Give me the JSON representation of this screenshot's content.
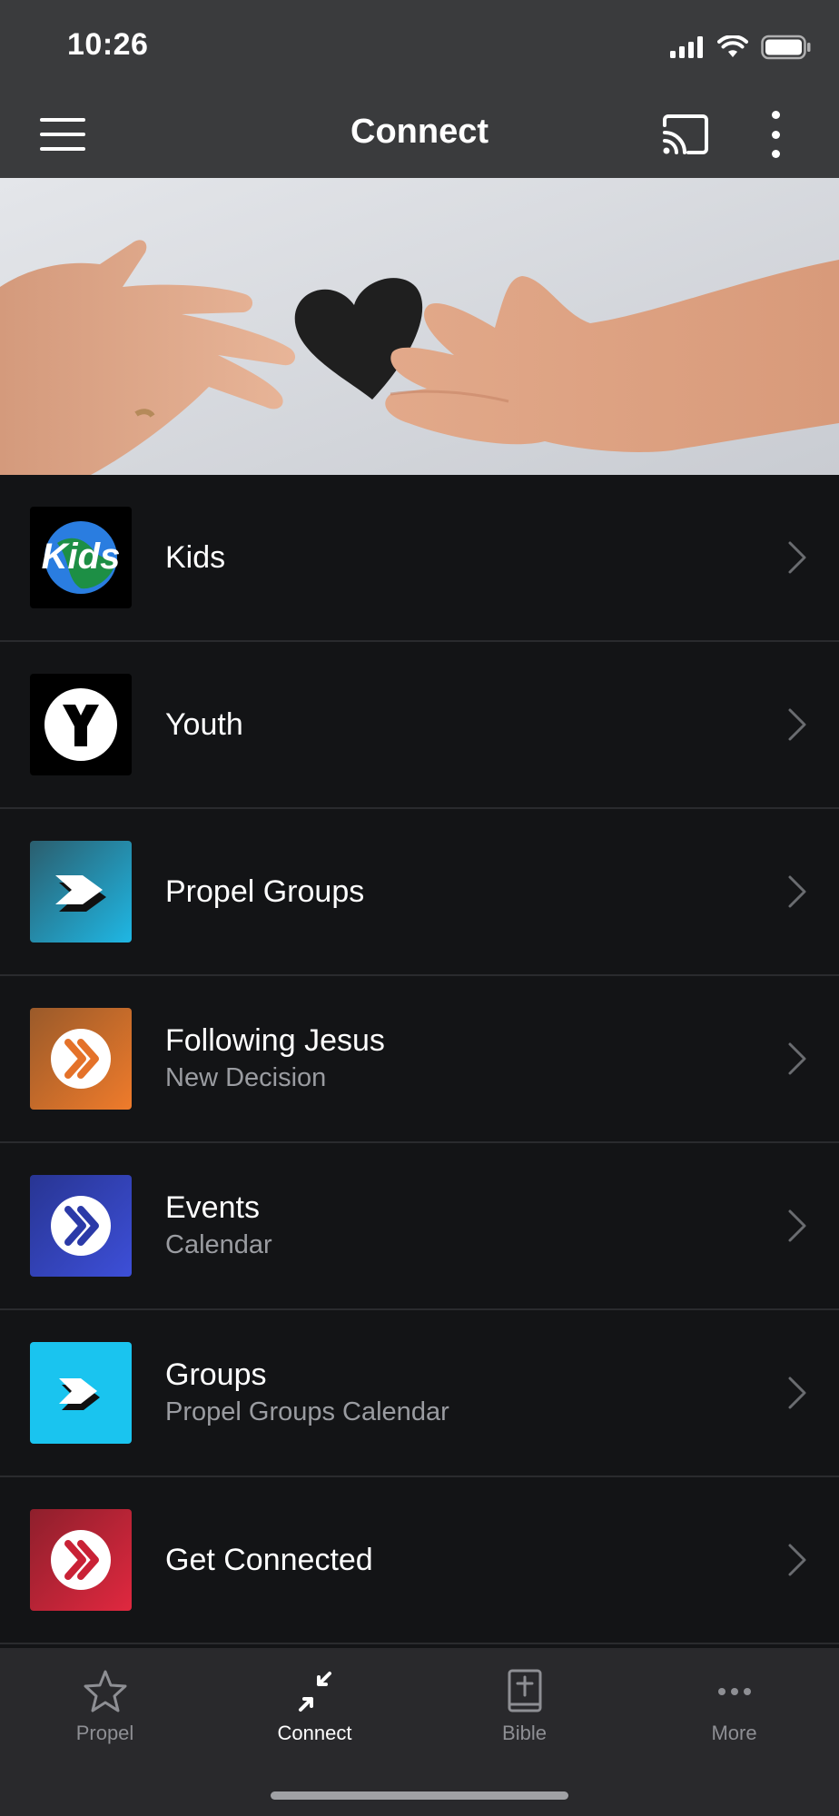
{
  "status_bar": {
    "time": "10:26"
  },
  "app_bar": {
    "title": "Connect"
  },
  "list": {
    "items": [
      {
        "title": "Kids",
        "subtitle": "",
        "icon": "kids-logo-icon",
        "color": "#000000"
      },
      {
        "title": "Youth",
        "subtitle": "",
        "icon": "youth-logo-icon",
        "color": "#000000"
      },
      {
        "title": "Propel Groups",
        "subtitle": "",
        "icon": "propel-groups-icon",
        "color": "#1fb7e4"
      },
      {
        "title": "Following Jesus",
        "subtitle": "New Decision",
        "icon": "following-jesus-icon",
        "color": "#ef7b2b"
      },
      {
        "title": "Events",
        "subtitle": "Calendar",
        "icon": "events-icon",
        "color": "#2b3aa8"
      },
      {
        "title": "Groups",
        "subtitle": "Propel Groups Calendar",
        "icon": "groups-icon",
        "color": "#1ac4ef"
      },
      {
        "title": "Get Connected",
        "subtitle": "",
        "icon": "get-connected-icon",
        "color": "#d8293f"
      }
    ]
  },
  "tab_bar": {
    "tabs": [
      {
        "label": "Propel",
        "icon": "star-icon",
        "active": false
      },
      {
        "label": "Connect",
        "icon": "connect-icon",
        "active": true
      },
      {
        "label": "Bible",
        "icon": "bible-icon",
        "active": false
      },
      {
        "label": "More",
        "icon": "more-dots-icon",
        "active": false
      }
    ]
  }
}
